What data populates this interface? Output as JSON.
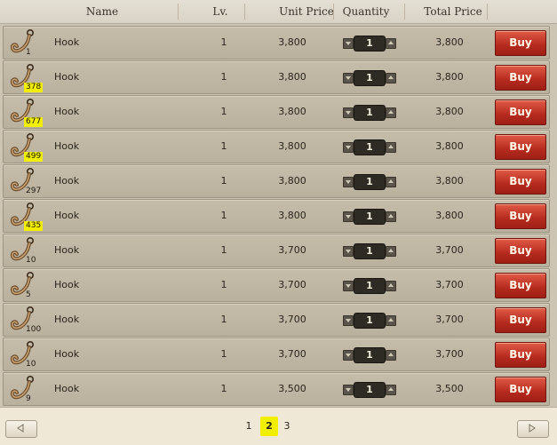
{
  "columns": {
    "name": "Name",
    "level": "Lv.",
    "unit_price": "Unit Price",
    "quantity": "Quantity",
    "total_price": "Total Price"
  },
  "rows": [
    {
      "count": "1",
      "name": "Hook",
      "level": "1",
      "unit_price": "3,800",
      "quantity": "1",
      "total_price": "3,800",
      "buy": "Buy",
      "highlighted": false
    },
    {
      "count": "378",
      "name": "Hook",
      "level": "1",
      "unit_price": "3,800",
      "quantity": "1",
      "total_price": "3,800",
      "buy": "Buy",
      "highlighted": true
    },
    {
      "count": "677",
      "name": "Hook",
      "level": "1",
      "unit_price": "3,800",
      "quantity": "1",
      "total_price": "3,800",
      "buy": "Buy",
      "highlighted": true
    },
    {
      "count": "499",
      "name": "Hook",
      "level": "1",
      "unit_price": "3,800",
      "quantity": "1",
      "total_price": "3,800",
      "buy": "Buy",
      "highlighted": true
    },
    {
      "count": "297",
      "name": "Hook",
      "level": "1",
      "unit_price": "3,800",
      "quantity": "1",
      "total_price": "3,800",
      "buy": "Buy",
      "highlighted": false
    },
    {
      "count": "435",
      "name": "Hook",
      "level": "1",
      "unit_price": "3,800",
      "quantity": "1",
      "total_price": "3,800",
      "buy": "Buy",
      "highlighted": true
    },
    {
      "count": "10",
      "name": "Hook",
      "level": "1",
      "unit_price": "3,700",
      "quantity": "1",
      "total_price": "3,700",
      "buy": "Buy",
      "highlighted": false
    },
    {
      "count": "5",
      "name": "Hook",
      "level": "1",
      "unit_price": "3,700",
      "quantity": "1",
      "total_price": "3,700",
      "buy": "Buy",
      "highlighted": false
    },
    {
      "count": "100",
      "name": "Hook",
      "level": "1",
      "unit_price": "3,700",
      "quantity": "1",
      "total_price": "3,700",
      "buy": "Buy",
      "highlighted": false
    },
    {
      "count": "10",
      "name": "Hook",
      "level": "1",
      "unit_price": "3,700",
      "quantity": "1",
      "total_price": "3,700",
      "buy": "Buy",
      "highlighted": false
    },
    {
      "count": "9",
      "name": "Hook",
      "level": "1",
      "unit_price": "3,500",
      "quantity": "1",
      "total_price": "3,500",
      "buy": "Buy",
      "highlighted": false
    }
  ],
  "pagination": {
    "pages": [
      "1",
      "2",
      "3"
    ],
    "current": "2"
  },
  "icons": {
    "item": "hook-icon",
    "qty_down": "arrow-down-icon",
    "qty_up": "arrow-up-icon",
    "prev": "arrow-left-icon",
    "next": "arrow-right-icon"
  },
  "colors": {
    "highlight": "#f1ee00",
    "buy_button": "#b52a1e"
  }
}
